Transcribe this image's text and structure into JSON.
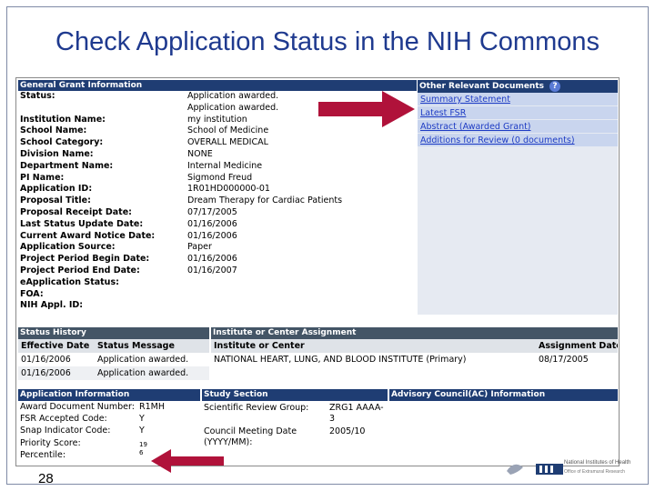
{
  "slide": {
    "title": "Check Application Status in the NIH Commons",
    "page_number": "28"
  },
  "general": {
    "header": "General Grant Information",
    "rows": [
      {
        "label": "Status:",
        "value": "Application awarded.\nApplication awarded."
      },
      {
        "label": "Institution Name:",
        "value": "my institution"
      },
      {
        "label": "School Name:",
        "value": "School of Medicine"
      },
      {
        "label": "School Category:",
        "value": "OVERALL MEDICAL"
      },
      {
        "label": "Division Name:",
        "value": "NONE"
      },
      {
        "label": "Department Name:",
        "value": "Internal Medicine"
      },
      {
        "label": "PI Name:",
        "value": "Sigmond Freud"
      },
      {
        "label": "Application ID:",
        "value": "1R01HD000000-01"
      },
      {
        "label": "Proposal Title:",
        "value": "Dream Therapy for Cardiac Patients"
      },
      {
        "label": "Proposal Receipt Date:",
        "value": "07/17/2005"
      },
      {
        "label": "Last Status Update Date:",
        "value": "01/16/2006"
      },
      {
        "label": "Current Award Notice Date:",
        "value": "01/16/2006"
      },
      {
        "label": "Application Source:",
        "value": "Paper"
      },
      {
        "label": "Project Period Begin Date:",
        "value": "01/16/2006"
      },
      {
        "label": "Project Period End Date:",
        "value": "01/16/2007"
      },
      {
        "label": "eApplication Status:",
        "value": ""
      },
      {
        "label": "FOA:",
        "value": ""
      },
      {
        "label": "NIH Appl. ID:",
        "value": ""
      }
    ]
  },
  "other_docs": {
    "header": "Other Relevant Documents",
    "links": [
      "Summary Statement",
      "Latest FSR",
      "Abstract (Awarded Grant)",
      "Additions for Review (0 documents)"
    ]
  },
  "status_history": {
    "header": "Status History",
    "columns": [
      "Effective Date",
      "Status Message"
    ],
    "rows": [
      [
        "01/16/2006",
        "Application awarded."
      ],
      [
        "01/16/2006",
        "Application awarded."
      ]
    ]
  },
  "institute": {
    "header": "Institute or Center Assignment",
    "columns": [
      "Institute or Center",
      "Assignment Date"
    ],
    "rows": [
      [
        "NATIONAL HEART, LUNG, AND BLOOD INSTITUTE (Primary)",
        "08/17/2005"
      ]
    ]
  },
  "app_info": {
    "header": "Application Information",
    "rows": [
      {
        "label": "Award Document Number:",
        "value": "R1MH"
      },
      {
        "label": "FSR Accepted Code:",
        "value": "Y"
      },
      {
        "label": "Snap Indicator Code:",
        "value": "Y"
      },
      {
        "label": "Priority Score:",
        "value": "19"
      },
      {
        "label": "Percentile:",
        "value": "6"
      }
    ]
  },
  "study_section": {
    "header": "Study Section",
    "rows": [
      {
        "label": "Scientific Review Group:",
        "value": "ZRG1 AAAA-3"
      },
      {
        "label": "Council Meeting Date (YYYY/MM):",
        "value": "2005/10"
      }
    ]
  },
  "advisory": {
    "header": "Advisory Council(AC) Information"
  },
  "logo": {
    "line1": "National Institutes of Health",
    "line2": "Office of Extramural Research"
  },
  "colors": {
    "title": "#1f3a8f",
    "header_bg": "#1f3d73",
    "link": "#1e3cc4",
    "arrow": "#b0123a"
  }
}
